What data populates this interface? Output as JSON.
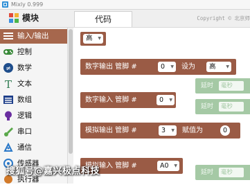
{
  "window": {
    "title": "Mixly 0.999"
  },
  "toolbox": {
    "header": "模块",
    "categories": [
      {
        "label": "输入/输出",
        "icon": "io-icon",
        "active": true
      },
      {
        "label": "控制",
        "icon": "gamepad-icon"
      },
      {
        "label": "数学",
        "icon": "math-icon"
      },
      {
        "label": "文本",
        "icon": "text-icon"
      },
      {
        "label": "数组",
        "icon": "array-icon"
      },
      {
        "label": "逻辑",
        "icon": "logic-bulb-icon"
      },
      {
        "label": "串口",
        "icon": "serial-icon"
      },
      {
        "label": "通信",
        "icon": "communication-icon"
      },
      {
        "label": "传感器",
        "icon": "sensor-icon"
      },
      {
        "label": "执行器",
        "icon": "actuator-icon"
      }
    ]
  },
  "tabs": {
    "code": "代码"
  },
  "copyright": "Copyright © 北京师",
  "blocks": {
    "level": {
      "value": "高"
    },
    "digital_write": {
      "label": "数字输出 管脚 #",
      "pin": "0",
      "set_as": "设为",
      "value": "高"
    },
    "digital_read": {
      "label": "数字输入 管脚 #",
      "pin": "0"
    },
    "analog_write": {
      "label": "模拟输出 管脚 #",
      "pin": "3",
      "assign": "赋值为",
      "value": "0"
    },
    "analog_read": {
      "label": "模拟输入 管脚 #",
      "pin": "A0"
    }
  },
  "background_blocks": [
    {
      "label": "延时",
      "unit": "毫秒"
    },
    {
      "label": "延时",
      "unit": "毫秒"
    },
    {
      "label": "延时",
      "unit": "毫秒"
    }
  ],
  "watermark": "搜狐号@嘉兴极点科技",
  "colors": {
    "io_block": "#9a5b45",
    "active_category": "#a6674d",
    "ghost_block": "#5c9e5d"
  }
}
